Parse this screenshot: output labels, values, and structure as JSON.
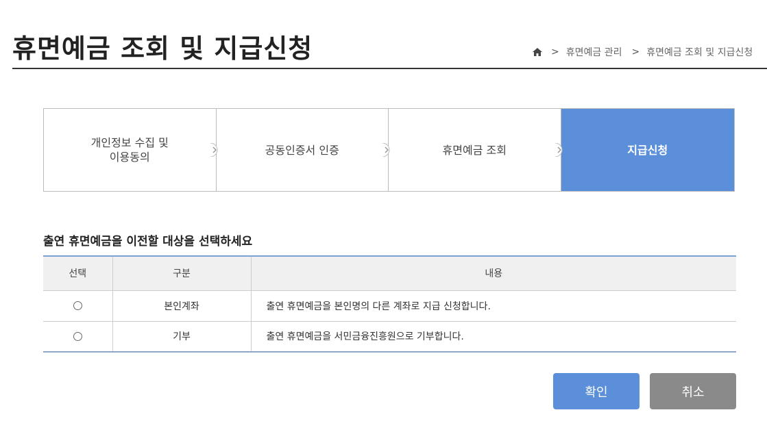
{
  "header": {
    "title": "휴면예금 조회 및 지급신청",
    "breadcrumb": [
      "휴면예금 관리",
      "휴면예금 조회 및 지급신청"
    ],
    "breadcrumb_sep": ">"
  },
  "steps": [
    {
      "label_line1": "개인정보 수집 및",
      "label_line2": "이용동의",
      "active": false
    },
    {
      "label_line1": "공동인증서 인증",
      "label_line2": "",
      "active": false
    },
    {
      "label_line1": "휴면예금 조회",
      "label_line2": "",
      "active": false
    },
    {
      "label_line1": "지급신청",
      "label_line2": "",
      "active": true
    }
  ],
  "section": {
    "title": "출연 휴면예금을 이전할 대상을 선택하세요"
  },
  "table": {
    "headers": [
      "선택",
      "구분",
      "내용"
    ],
    "rows": [
      {
        "category": "본인계좌",
        "description": "출연 휴면예금을 본인명의 다른 계좌로 지급 신청합니다."
      },
      {
        "category": "기부",
        "description": "출연 휴면예금을 서민금융진흥원으로 기부합니다."
      }
    ]
  },
  "buttons": {
    "confirm": "확인",
    "cancel": "취소"
  },
  "colors": {
    "accent": "#5b8fd9",
    "cancel": "#8a8a8a"
  }
}
